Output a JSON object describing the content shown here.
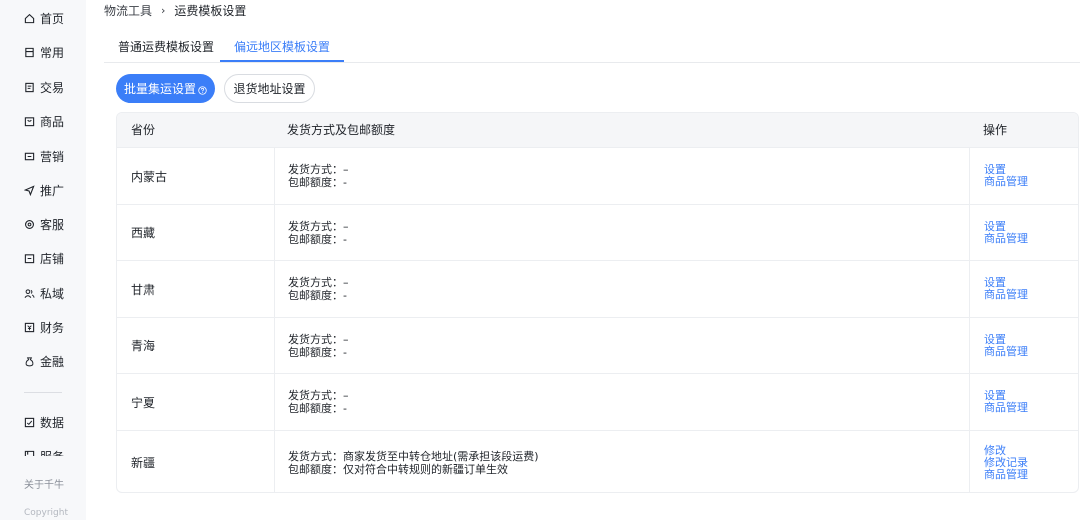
{
  "sidebar": {
    "items": [
      {
        "label": "首页",
        "icon": "home-icon"
      },
      {
        "label": "常用",
        "icon": "bookmark-icon"
      },
      {
        "label": "交易",
        "icon": "order-icon"
      },
      {
        "label": "商品",
        "icon": "bag-icon"
      },
      {
        "label": "营销",
        "icon": "coupon-icon"
      },
      {
        "label": "推广",
        "icon": "send-icon"
      },
      {
        "label": "客服",
        "icon": "headset-icon"
      },
      {
        "label": "店铺",
        "icon": "shop-icon"
      },
      {
        "label": "私域",
        "icon": "users-icon"
      },
      {
        "label": "财务",
        "icon": "finance-icon"
      },
      {
        "label": "金融",
        "icon": "money-bag-icon"
      },
      {
        "label": "数据",
        "icon": "chart-icon"
      },
      {
        "label": "服务",
        "icon": "service-icon"
      }
    ],
    "footer_about": "关于千牛",
    "footer_copyright": "Copyright"
  },
  "breadcrumb": {
    "first": "物流工具",
    "separator": "›",
    "current": "运费模板设置"
  },
  "tabs": [
    {
      "label": "普通运费模板设置",
      "active": false
    },
    {
      "label": "偏远地区模板设置",
      "active": true
    }
  ],
  "toolbar": {
    "batch_label": "批量集运设置",
    "return_label": "退货地址设置"
  },
  "table": {
    "headers": {
      "province": "省份",
      "shipping": "发货方式及包邮额度",
      "ops": "操作"
    },
    "rows": [
      {
        "province": "内蒙古",
        "method": "发货方式：–",
        "quota": "包邮额度：-",
        "ops": [
          "设置",
          "商品管理"
        ]
      },
      {
        "province": "西藏",
        "method": "发货方式：–",
        "quota": "包邮额度：-",
        "ops": [
          "设置",
          "商品管理"
        ]
      },
      {
        "province": "甘肃",
        "method": "发货方式：–",
        "quota": "包邮额度：-",
        "ops": [
          "设置",
          "商品管理"
        ]
      },
      {
        "province": "青海",
        "method": "发货方式：–",
        "quota": "包邮额度：-",
        "ops": [
          "设置",
          "商品管理"
        ]
      },
      {
        "province": "宁夏",
        "method": "发货方式：–",
        "quota": "包邮额度：-",
        "ops": [
          "设置",
          "商品管理"
        ]
      },
      {
        "province": "新疆",
        "method": "发货方式：商家发货至中转仓地址(需承担该段运费)",
        "quota": "包邮额度：仅对符合中转规则的新疆订单生效",
        "ops": [
          "修改",
          "修改记录",
          "商品管理"
        ]
      }
    ]
  },
  "colors": {
    "accent": "#3b7ef8",
    "sidebar_bg": "#f7f8fa",
    "table_header_bg": "#f5f6f8"
  }
}
